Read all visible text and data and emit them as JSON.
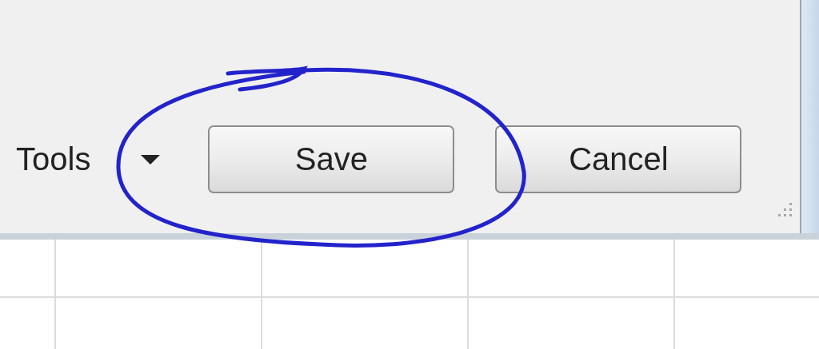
{
  "tools_menu": {
    "label": "Tools"
  },
  "buttons": [
    {
      "label": "Save"
    },
    {
      "label": "Cancel"
    }
  ]
}
